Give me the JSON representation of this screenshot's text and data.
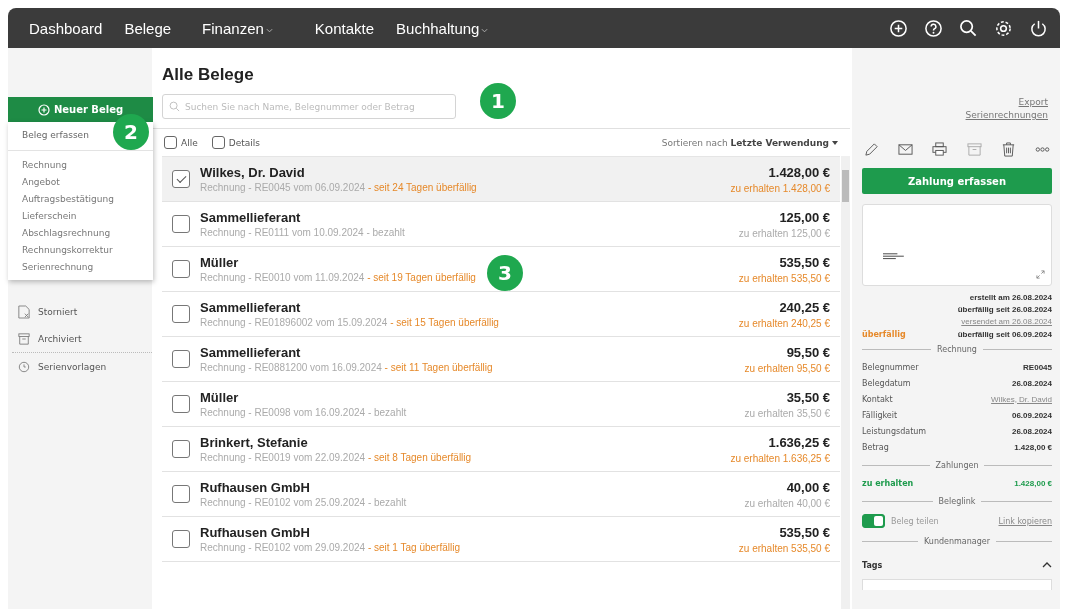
{
  "nav": {
    "items": [
      {
        "label": "Dashboard",
        "dropdown": false
      },
      {
        "label": "Belege",
        "dropdown": false
      },
      {
        "label": "Finanzen",
        "dropdown": true
      },
      {
        "label": "Kontakte",
        "dropdown": false
      },
      {
        "label": "Buchhaltung",
        "dropdown": true
      }
    ]
  },
  "sidebar": {
    "new_button": "Neuer Beleg",
    "menu": {
      "header": "Beleg erfassen",
      "items": [
        "Rechnung",
        "Angebot",
        "Auftragsbestätigung",
        "Lieferschein",
        "Abschlagsrechnung",
        "Rechnungskorrektur",
        "Serienrechnung"
      ]
    },
    "items": [
      {
        "label": "Storniert"
      },
      {
        "label": "Archiviert"
      },
      {
        "label": "Serienvorlagen"
      }
    ]
  },
  "main": {
    "title": "Alle Belege",
    "search": {
      "placeholder": "Suchen Sie nach Name, Belegnummer oder Betrag"
    },
    "links": [
      "Export",
      "Serienrechnungen"
    ],
    "filters": [
      {
        "label": "Alle",
        "checked": false
      },
      {
        "label": "Details",
        "checked": false
      }
    ],
    "sort_label": "Sortieren nach",
    "sort_value": "Letzte Verwendung",
    "rows": [
      {
        "name": "Wilkes, Dr. David",
        "meta": "Rechnung - RE0045 vom 06.09.2024",
        "status": "- seit 24 Tagen überfällig",
        "kind": "overdue",
        "amount": "1.428,00 €",
        "due": "zu erhalten 1.428,00 €",
        "selected": true
      },
      {
        "name": "Sammellieferant",
        "meta": "Rechnung - RE0111 vom 10.09.2024",
        "status": "- bezahlt",
        "kind": "paid",
        "amount": "125,00 €",
        "due": "zu erhalten 125,00 €",
        "selected": false
      },
      {
        "name": "Müller",
        "meta": "Rechnung - RE0010 vom 11.09.2024",
        "status": "- seit 19 Tagen überfällig",
        "kind": "overdue",
        "amount": "535,50 €",
        "due": "zu erhalten 535,50 €",
        "selected": false
      },
      {
        "name": "Sammellieferant",
        "meta": "Rechnung - RE01896002 vom 15.09.2024",
        "status": "- seit 15 Tagen überfällig",
        "kind": "overdue",
        "amount": "240,25 €",
        "due": "zu erhalten 240,25 €",
        "selected": false
      },
      {
        "name": "Sammellieferant",
        "meta": "Rechnung - RE0881200 vom 16.09.2024",
        "status": "- seit 11 Tagen überfällig",
        "kind": "overdue",
        "amount": "95,50 €",
        "due": "zu erhalten 95,50 €",
        "selected": false
      },
      {
        "name": "Müller",
        "meta": "Rechnung - RE0098 vom 16.09.2024",
        "status": "- bezahlt",
        "kind": "paid",
        "amount": "35,50 €",
        "due": "zu erhalten 35,50 €",
        "selected": false
      },
      {
        "name": "Brinkert, Stefanie",
        "meta": "Rechnung - RE0019 vom 22.09.2024",
        "status": "- seit 8 Tagen überfällig",
        "kind": "overdue",
        "amount": "1.636,25 €",
        "due": "zu erhalten 1.636,25 €",
        "selected": false
      },
      {
        "name": "Rufhausen GmbH",
        "meta": "Rechnung - RE0102 vom 25.09.2024",
        "status": "- bezahlt",
        "kind": "paid",
        "amount": "40,00 €",
        "due": "zu erhalten 40,00 €",
        "selected": false
      },
      {
        "name": "Rufhausen GmbH",
        "meta": "Rechnung - RE0102 vom 29.09.2024",
        "status": "- seit 1 Tag überfällig",
        "kind": "overdue",
        "amount": "535,50 €",
        "due": "zu erhalten 535,50 €",
        "selected": false
      }
    ]
  },
  "detail": {
    "pay_button": "Zahlung erfassen",
    "history": [
      {
        "text": "erstellt am 26.08.2024",
        "kind": "plain"
      },
      {
        "text": "überfällig seit 26.08.2024",
        "kind": "plain"
      },
      {
        "text": "versendet am 26.08.2024",
        "kind": "link"
      }
    ],
    "status_badge": "überfällig",
    "status_text": "überfällig seit 06.09.2024",
    "sections": [
      {
        "title": "Rechnung",
        "fields": [
          {
            "label": "Belegnummer",
            "value": "RE0045",
            "kind": "plain"
          },
          {
            "label": "Belegdatum",
            "value": "26.08.2024",
            "kind": "plain"
          },
          {
            "label": "Kontakt",
            "value": "Wilkes, Dr. David",
            "kind": "link"
          },
          {
            "label": "Fälligkeit",
            "value": "06.09.2024",
            "kind": "plain"
          },
          {
            "label": "Leistungsdatum",
            "value": "26.08.2024",
            "kind": "plain"
          },
          {
            "label": "Betrag",
            "value": "1.428,00 €",
            "kind": "plain"
          }
        ]
      },
      {
        "title": "Zahlungen",
        "fields": [
          {
            "label": "zu erhalten",
            "value": "1.428,00 €",
            "kind": "positive"
          }
        ]
      }
    ],
    "link_section": "Beleglink",
    "share": {
      "label": "Beleg teilen",
      "on": true
    },
    "copy_link": "Link kopieren",
    "manager_section": "Kundenmanager",
    "tags_label": "Tags"
  },
  "callouts": [
    "1",
    "2",
    "3"
  ]
}
